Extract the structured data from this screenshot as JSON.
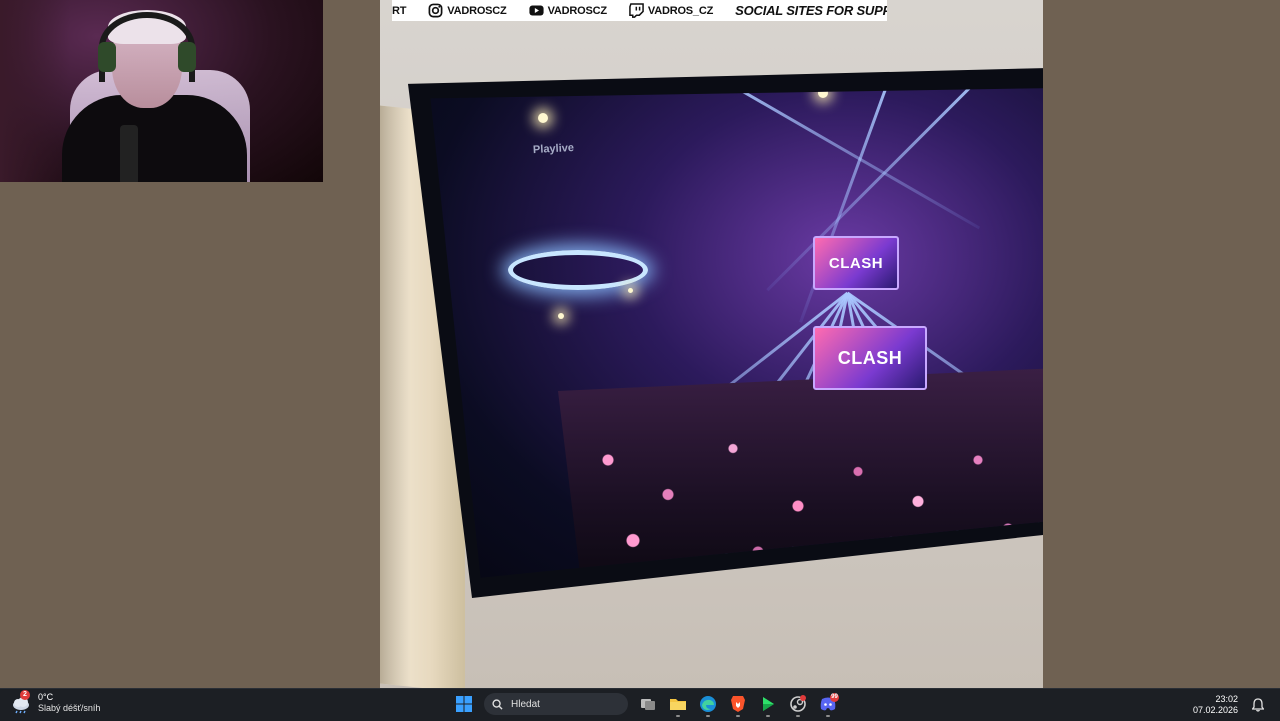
{
  "social_banner": {
    "items": [
      {
        "icon": "partial-text",
        "label": "RT"
      },
      {
        "icon": "instagram-icon",
        "label": "VADROSCZ"
      },
      {
        "icon": "youtube-icon",
        "label": "VADROSCZ"
      },
      {
        "icon": "twitch-icon",
        "label": "VADROS_CZ"
      },
      {
        "icon": "none",
        "label": "SOCIAL SITES FOR SUPPO"
      }
    ]
  },
  "video": {
    "tv_watermark": "Playlive",
    "stage_screen_text": "CLASH"
  },
  "taskbar": {
    "weather": {
      "temperature": "0°C",
      "description": "Slabý déšť/sníh",
      "badge": "2"
    },
    "search_placeholder": "Hledat",
    "apps": [
      {
        "name": "start",
        "icon": "windows-icon"
      },
      {
        "name": "task-view",
        "icon": "task-view-icon"
      },
      {
        "name": "file-explorer",
        "icon": "folder-icon"
      },
      {
        "name": "edge",
        "icon": "edge-icon"
      },
      {
        "name": "brave",
        "icon": "brave-icon"
      },
      {
        "name": "green-app",
        "icon": "play-icon"
      },
      {
        "name": "steam-app",
        "icon": "steam-icon"
      },
      {
        "name": "discord",
        "icon": "discord-icon"
      }
    ],
    "discord_badge": "99",
    "time": "23:02",
    "date": "07.02.2026"
  },
  "colors": {
    "background": "#6f6152",
    "taskbar": "#1c1f24",
    "accent_windows": "#3aa0ff"
  }
}
